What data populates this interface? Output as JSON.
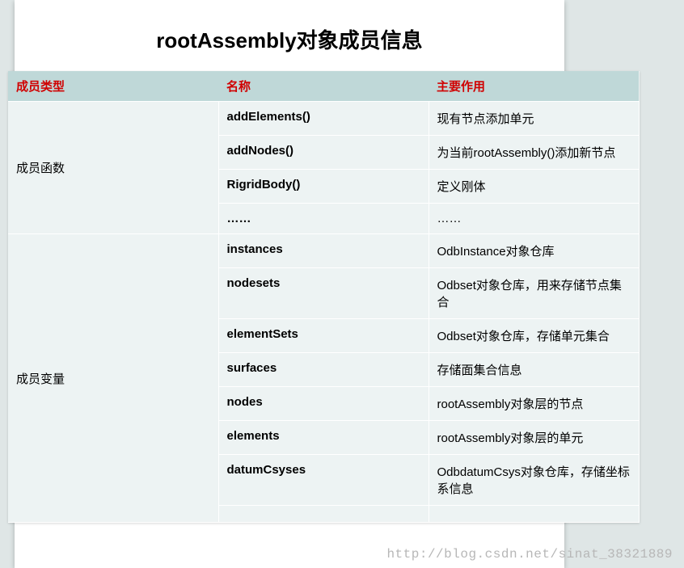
{
  "title": "rootAssembly对象成员信息",
  "headers": [
    "成员类型",
    "名称",
    "主要作用"
  ],
  "groups": [
    {
      "type": "成员函数",
      "rows": [
        {
          "name": "addElements()",
          "desc": "现有节点添加单元",
          "tall": false
        },
        {
          "name": "addNodes()",
          "desc": "为当前rootAssembly()添加新节点",
          "tall": false
        },
        {
          "name": "RigridBody()",
          "desc": "定义刚体",
          "tall": false
        },
        {
          "name": "……",
          "desc": "……",
          "tall": false
        }
      ]
    },
    {
      "type": "成员变量",
      "rows": [
        {
          "name": "instances",
          "desc": "OdbInstance对象仓库",
          "tall": false
        },
        {
          "name": "nodesets",
          "desc": "Odbset对象仓库，用来存储节点集合",
          "tall": false
        },
        {
          "name": "elementSets",
          "desc": "Odbset对象仓库，存储单元集合",
          "tall": false
        },
        {
          "name": "surfaces",
          "desc": "存储面集合信息",
          "tall": false
        },
        {
          "name": "nodes",
          "desc": "rootAssembly对象层的节点",
          "tall": true
        },
        {
          "name": "elements",
          "desc": "rootAssembly对象层的单元",
          "tall": true
        },
        {
          "name": "datumCsyses",
          "desc": "OdbdatumCsys对象仓库，存储坐标系信息",
          "tall": false
        },
        {
          "name": "",
          "desc": "",
          "tall": false
        }
      ]
    }
  ],
  "watermark": "http://blog.csdn.net/sinat_38321889"
}
